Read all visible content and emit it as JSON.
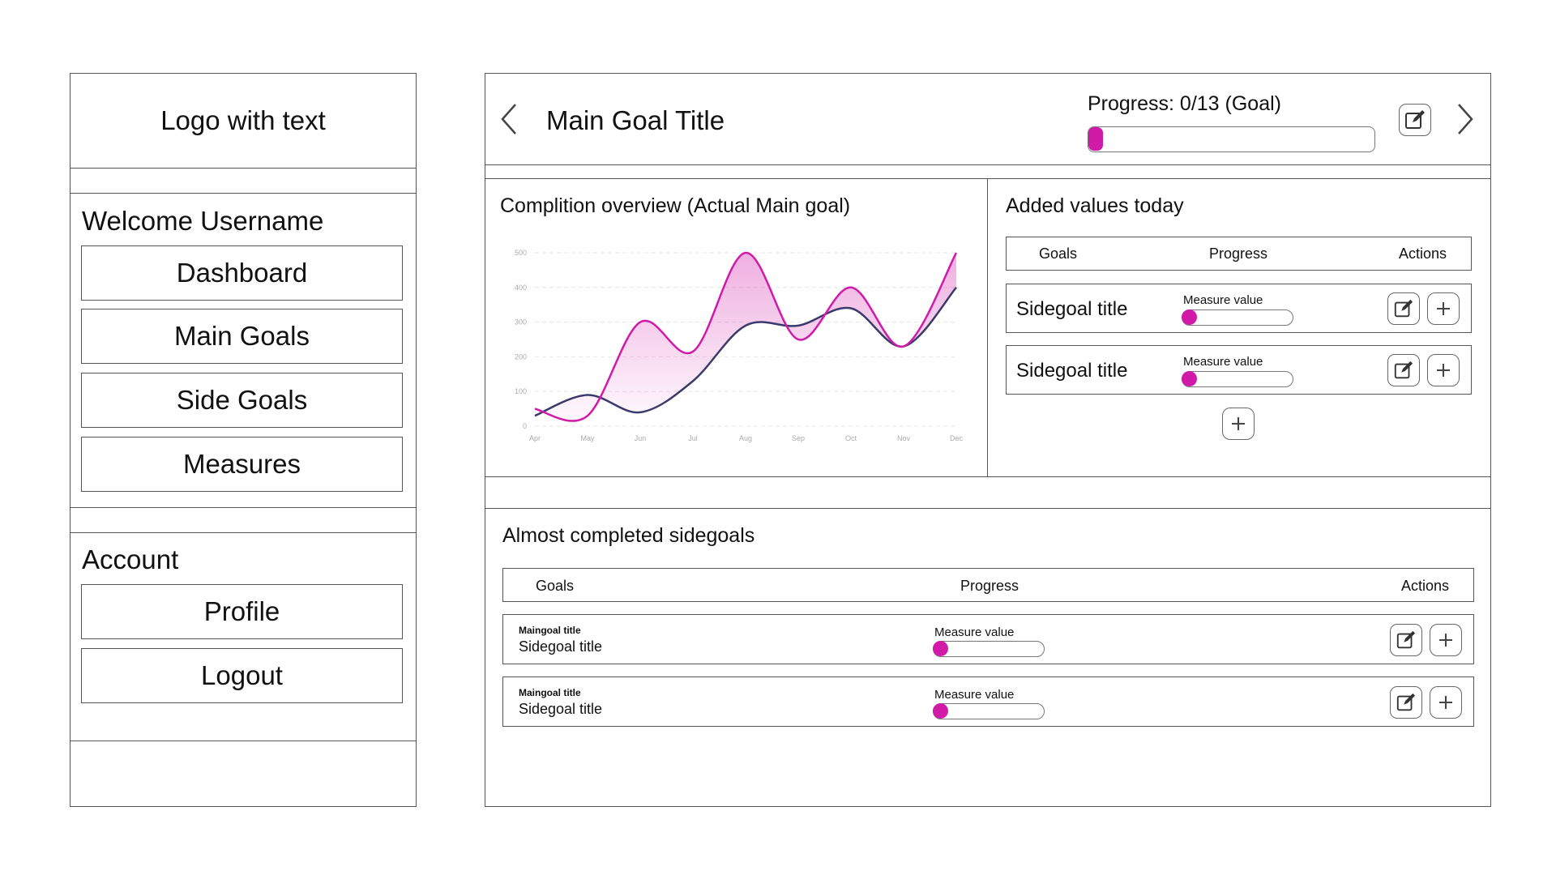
{
  "sidebar": {
    "logo_text": "Logo with text",
    "welcome": "Welcome Username",
    "nav": [
      "Dashboard",
      "Main Goals",
      "Side Goals",
      "Measures"
    ],
    "account_heading": "Account",
    "account": [
      "Profile",
      "Logout"
    ]
  },
  "header": {
    "title": "Main Goal Title",
    "progress_label": "Progress: 0/13 (Goal)",
    "progress_fraction": 0.0
  },
  "overview": {
    "title": "Complition overview (Actual Main goal)"
  },
  "chart_data": {
    "type": "line",
    "categories": [
      "Apr",
      "May",
      "Jun",
      "Jul",
      "Aug",
      "Sep",
      "Oct",
      "Nov",
      "Dec"
    ],
    "y_ticks": [
      "0",
      "100",
      "200",
      "300",
      "400",
      "500"
    ],
    "ylim": [
      0,
      500
    ],
    "series": [
      {
        "values": [
          50,
          30,
          300,
          215,
          500,
          250,
          400,
          230,
          500
        ]
      },
      {
        "values": [
          30,
          90,
          40,
          130,
          290,
          290,
          340,
          230,
          400
        ]
      }
    ],
    "grid": true,
    "colors": [
      "#d11aa8",
      "#3a3a6b"
    ]
  },
  "added_today": {
    "title": "Added values today",
    "headers": [
      "Goals",
      "Progress",
      "Actions"
    ],
    "rows": [
      {
        "title": "Sidegoal title",
        "measure": "Measure value"
      },
      {
        "title": "Sidegoal title",
        "measure": "Measure value"
      }
    ]
  },
  "almost": {
    "title": "Almost completed sidegoals",
    "headers": [
      "Goals",
      "Progress",
      "Actions"
    ],
    "rows": [
      {
        "main": "Maingoal title",
        "title": "Sidegoal title",
        "measure": "Measure value"
      },
      {
        "main": "Maingoal title",
        "title": "Sidegoal title",
        "measure": "Measure value"
      }
    ]
  },
  "colors": {
    "accent": "#d11aa8",
    "secondary_line": "#3a3a6b",
    "border": "#555555"
  }
}
